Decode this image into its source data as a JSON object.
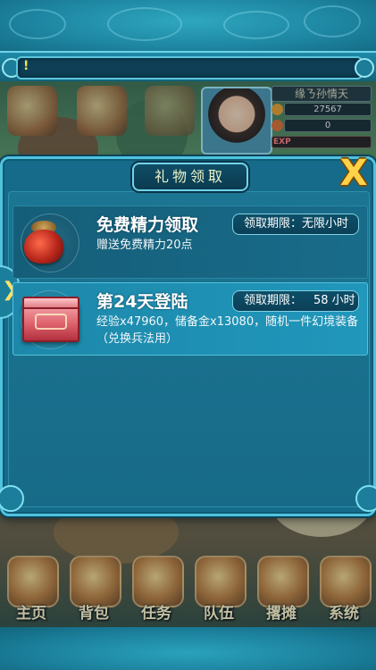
{
  "chat": {
    "cursor_text": "!"
  },
  "hud": {
    "player_name": "缘ㄋ孙情天",
    "currency_1": "27567",
    "currency_2": "0",
    "exp_label": "EXP"
  },
  "dialog": {
    "title": "礼物领取",
    "close_label": "X",
    "side_arrow": "❯",
    "gifts": [
      {
        "icon": "jar-icon",
        "title": "免费精力领取",
        "limit_label": "领取期限：",
        "limit_value": "无限小时",
        "desc": "赠送免费精力20点"
      },
      {
        "icon": "chest-icon",
        "title": "第24天登陆",
        "limit_label": "领取期限：",
        "limit_value": "58  小时",
        "desc": "经验x47960，储备金x13080，随机一件幻境装备（兑换兵法用）"
      }
    ]
  },
  "nav": {
    "items": [
      {
        "label": "主页"
      },
      {
        "label": "背包"
      },
      {
        "label": "任务"
      },
      {
        "label": "队伍"
      },
      {
        "label": "撂摊"
      },
      {
        "label": "系统"
      }
    ]
  },
  "colors": {
    "frame": "#4fc3de",
    "panel": "#166b8a",
    "highlight_row": "#2097bb",
    "close_x": "#ffd24a"
  }
}
